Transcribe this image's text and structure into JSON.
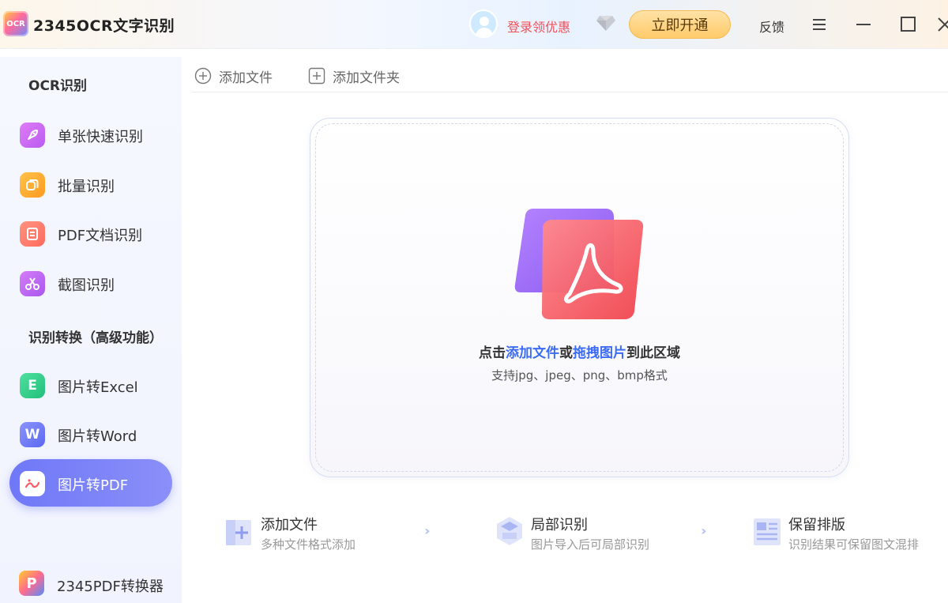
{
  "app": {
    "logo_text": "OCR",
    "title": "2345OCR文字识别"
  },
  "header": {
    "login_text": "登录领优惠",
    "vip_button": "立即开通",
    "feedback": "反馈"
  },
  "sidebar": {
    "section_ocr": "OCR识别",
    "section_convert": "识别转换（高级功能）",
    "items": [
      {
        "label": "单张快速识别",
        "icon": "rocket-icon",
        "color": "#d46ef5"
      },
      {
        "label": "批量识别",
        "icon": "stack-icon",
        "color": "#ffac2e"
      },
      {
        "label": "PDF文档识别",
        "icon": "document-icon",
        "color": "#ff7a6b"
      },
      {
        "label": "截图识别",
        "icon": "scissors-icon",
        "color": "#c467f0"
      },
      {
        "label": "图片转Excel",
        "icon": "excel-icon",
        "color": "#3ccf8e",
        "glyph": "E"
      },
      {
        "label": "图片转Word",
        "icon": "word-icon",
        "color": "#6c7cf6",
        "glyph": "W"
      },
      {
        "label": "图片转PDF",
        "icon": "pdf-icon",
        "color": "#ff6b6b",
        "active": true
      }
    ],
    "bottom_link": "2345PDF转换器"
  },
  "toolbar": {
    "add_file": "添加文件",
    "add_folder": "添加文件夹"
  },
  "dropzone": {
    "prefix": "点击",
    "link1": "添加文件",
    "mid": "或",
    "link2": "拖拽图片",
    "suffix": "到此区域",
    "formats": "支持jpg、jpeg、png、bmp格式"
  },
  "features": [
    {
      "title": "添加文件",
      "desc": "多种文件格式添加"
    },
    {
      "title": "局部识别",
      "desc": "图片导入后可局部识别"
    },
    {
      "title": "保留排版",
      "desc": "识别结果可保留图文混排"
    }
  ],
  "colors": {
    "accent": "#6f78f7",
    "link": "#3b6cf5",
    "vip": "#ffca6a",
    "login": "#f0525a"
  }
}
